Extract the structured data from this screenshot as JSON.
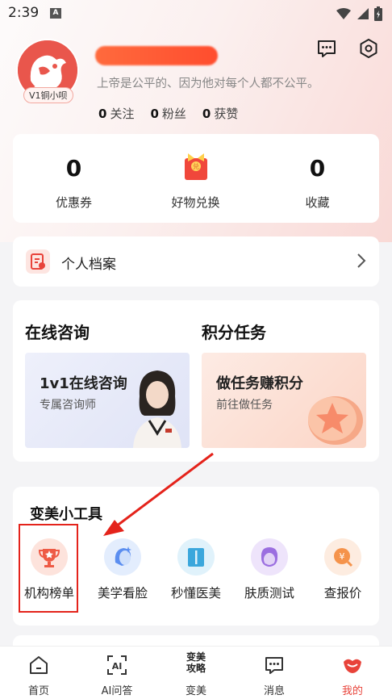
{
  "status_bar": {
    "time": "2:39",
    "sim_label": "A"
  },
  "profile": {
    "badge": "V1铜小呗",
    "bio": "上帝是公平的、因为他对每个人都不公平。",
    "stats": [
      {
        "count": "0",
        "label": "关注"
      },
      {
        "count": "0",
        "label": "粉丝"
      },
      {
        "count": "0",
        "label": "获赞"
      }
    ]
  },
  "summary": {
    "items": [
      {
        "value": "0",
        "label": "优惠券"
      },
      {
        "value": "",
        "label": "好物兑换"
      },
      {
        "value": "0",
        "label": "收藏"
      }
    ]
  },
  "archive": {
    "label": "个人档案"
  },
  "services": {
    "consult_title": "在线咨询",
    "points_title": "积分任务",
    "consult_banner": {
      "title": "1v1在线咨询",
      "subtitle": "专属咨询师"
    },
    "points_banner": {
      "title": "做任务赚积分",
      "subtitle": "前往做任务"
    }
  },
  "tools": {
    "title": "变美小工具",
    "items": [
      {
        "label": "机构榜单",
        "icon": "trophy-icon",
        "color": "#f4c8bd"
      },
      {
        "label": "美学看脸",
        "icon": "face-scan-icon",
        "color": "#cfe0fb"
      },
      {
        "label": "秒懂医美",
        "icon": "book-icon",
        "color": "#cbe8f6"
      },
      {
        "label": "肤质测试",
        "icon": "skin-test-icon",
        "color": "#e2d3f6"
      },
      {
        "label": "查报价",
        "icon": "price-icon",
        "color": "#fde0cb"
      }
    ]
  },
  "tabbar": {
    "items": [
      {
        "label": "首页",
        "icon": "home-icon"
      },
      {
        "label": "AI问答",
        "icon": "ai-icon"
      },
      {
        "label": "变美",
        "icon": "beauty-strategy-icon",
        "icon_text_top": "变美",
        "icon_text_bottom": "攻略"
      },
      {
        "label": "消息",
        "icon": "message-icon"
      },
      {
        "label": "我的",
        "icon": "my-icon"
      }
    ],
    "active_color": "#e8433a"
  },
  "colors": {
    "accent": "#e8433a",
    "highlight_box": "#e4231b"
  }
}
